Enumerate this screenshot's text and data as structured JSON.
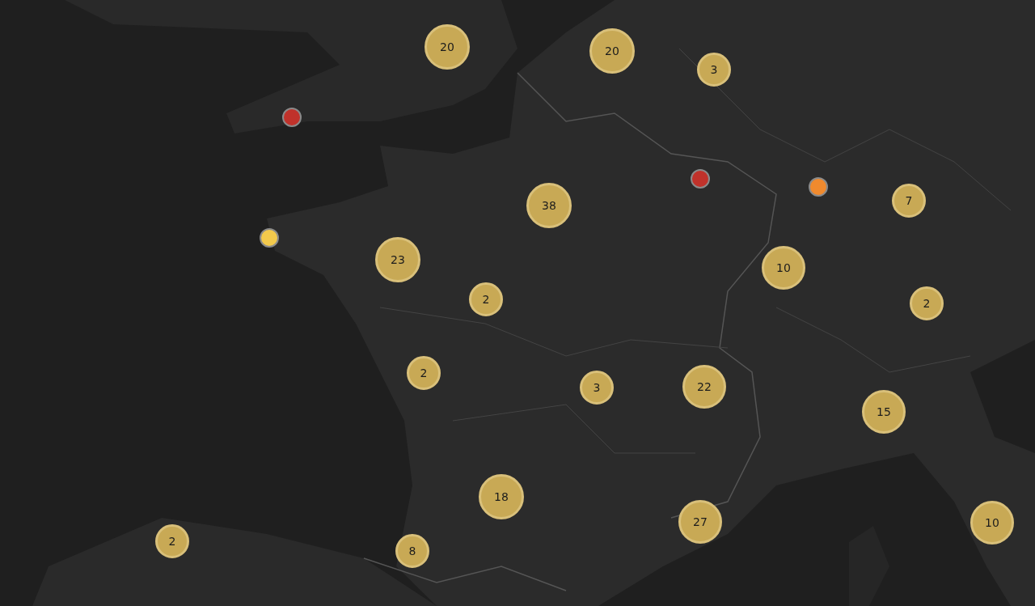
{
  "clusters": [
    {
      "count": "20"
    },
    {
      "count": "20"
    },
    {
      "count": "3"
    },
    {
      "count": "38"
    },
    {
      "count": "23"
    },
    {
      "count": "2"
    },
    {
      "count": "10"
    },
    {
      "count": "7"
    },
    {
      "count": "2"
    },
    {
      "count": "2"
    },
    {
      "count": "3"
    },
    {
      "count": "22"
    },
    {
      "count": "15"
    },
    {
      "count": "18"
    },
    {
      "count": "27"
    },
    {
      "count": "10"
    },
    {
      "count": "2"
    },
    {
      "count": "8"
    }
  ],
  "markers": [
    {
      "color": "#c0322b"
    },
    {
      "color": "#c0322b"
    },
    {
      "color": "#f2c94c"
    },
    {
      "color": "#f08a2e"
    }
  ]
}
